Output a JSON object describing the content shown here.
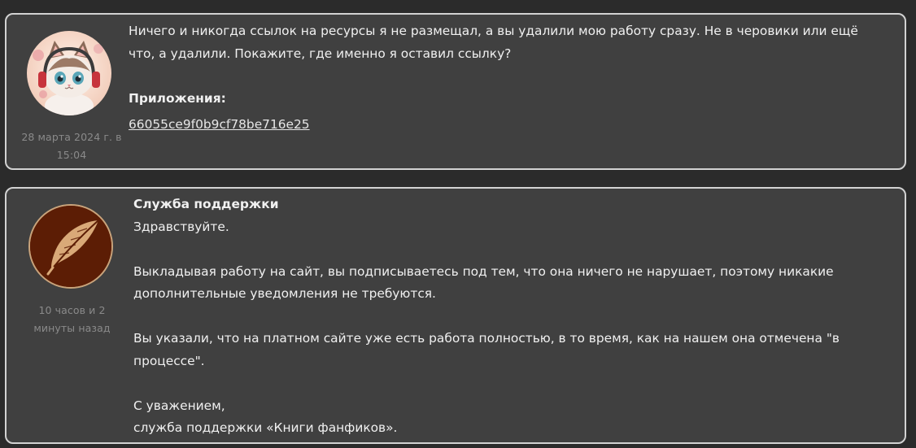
{
  "messages": [
    {
      "author": "",
      "text_lines": [
        "Ничего и никогда ссылок на ресурсы я не размещал, а вы удалили мою работу сразу. Не в черовики или ещё",
        "что, а удалили. Покажите, где именно я оставил ссылку?"
      ],
      "attachments_label": "Приложения:",
      "attachment_name": "66055ce9f0b9cf78be716e25",
      "date_line1": "28 марта 2024 г. в",
      "date_line2": "15:04"
    },
    {
      "author": "Служба поддержки",
      "greeting": "Здравствуйте.",
      "para1": "Выкладывая работу на сайт, вы подписываетесь под тем, что она ничего не нарушает, поэтому никакие дополнительные уведомления не требуются.",
      "para2": "Вы указали, что на платном сайте уже есть работа полностью, в то время, как на нашем она отмечена \"в процессе\".",
      "sign1": "С уважением,",
      "sign2": "служба поддержки «Книги фанфиков».",
      "date_line1": "10 часов и 2",
      "date_line2": "минуты назад"
    }
  ],
  "colors": {
    "background": "#2b2b2b",
    "card": "#404040",
    "border": "#d2d2d2",
    "support_avatar_bg": "#5c1d05",
    "feather": "#d9a978"
  },
  "icons": {
    "user_avatar": "kitten-with-headphones-avatar",
    "support_avatar": "feather-icon"
  }
}
